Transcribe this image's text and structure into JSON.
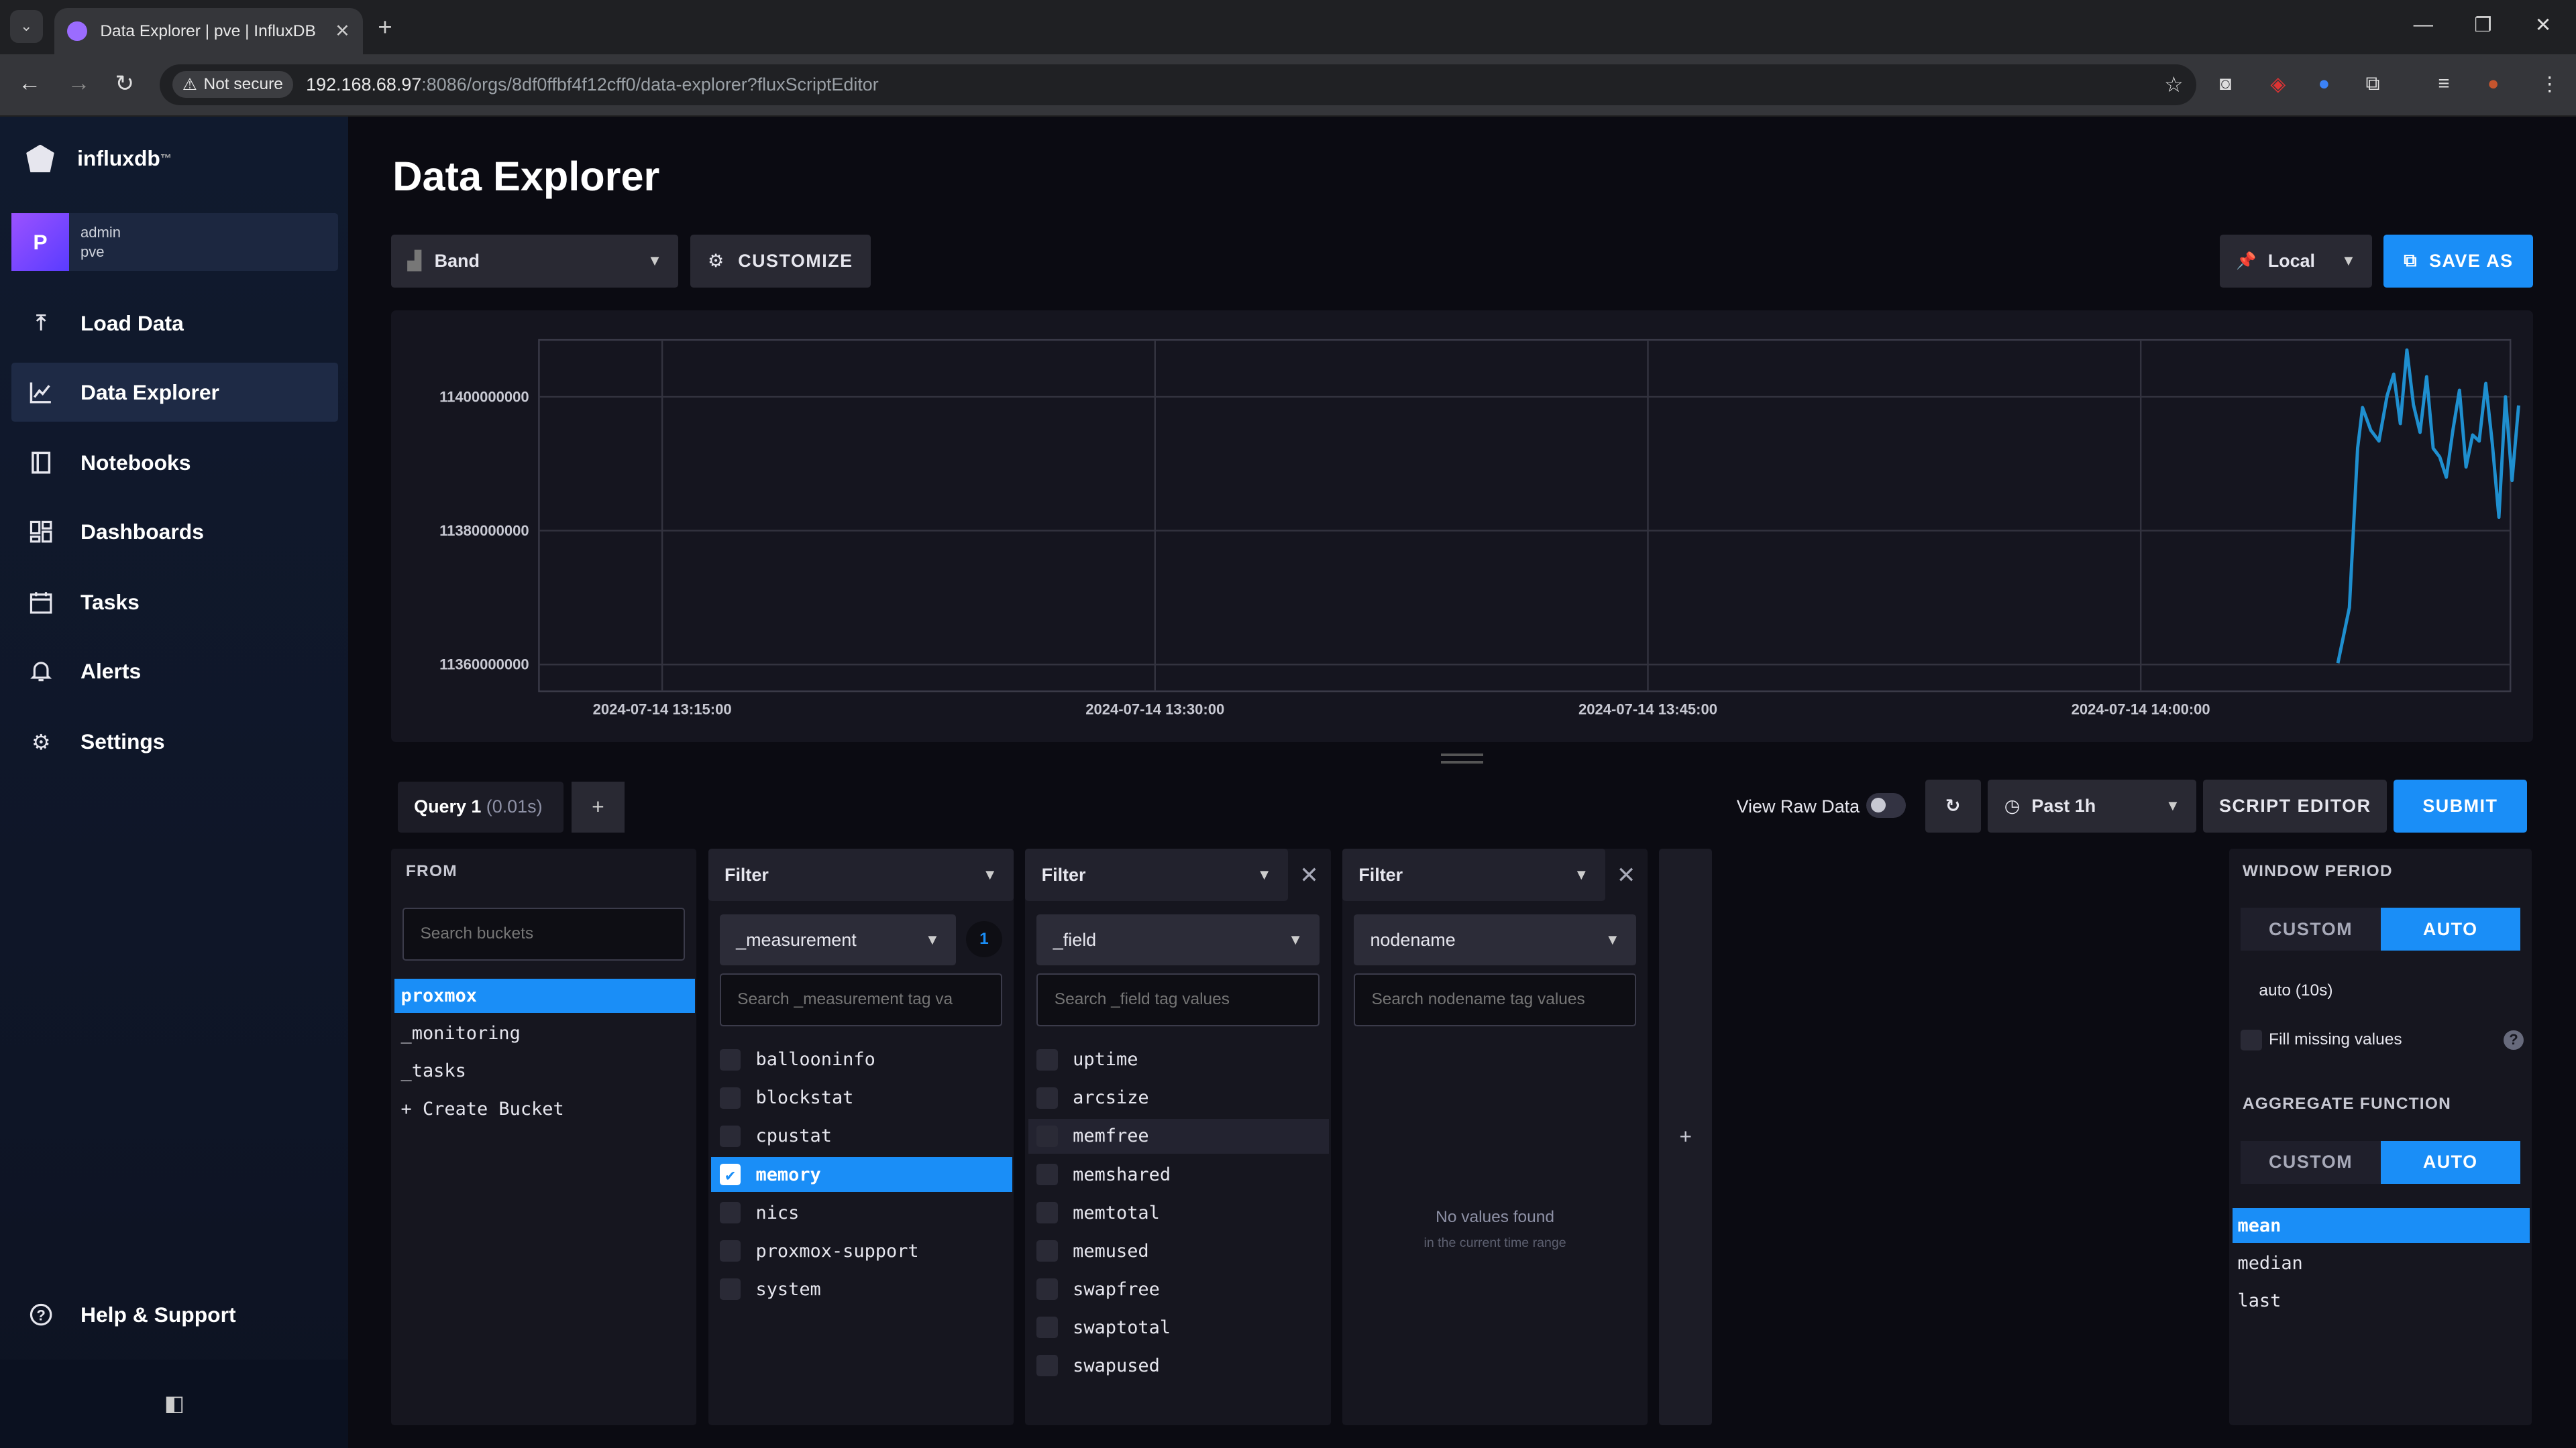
{
  "browser": {
    "tab_title": "Data Explorer | pve | InfluxDB",
    "not_secure": "Not secure",
    "url_host": "192.168.68.97",
    "url_path": ":8086/orgs/8df0ffbf4f12cff0/data-explorer?fluxScriptEditor"
  },
  "sidebar": {
    "brand": "influxdb",
    "brand_mark": "™",
    "user": {
      "initial": "P",
      "role": "admin",
      "org": "pve"
    },
    "items": [
      {
        "label": "Load Data",
        "icon": "upload-icon"
      },
      {
        "label": "Data Explorer",
        "icon": "graph-icon"
      },
      {
        "label": "Notebooks",
        "icon": "notebook-icon"
      },
      {
        "label": "Dashboards",
        "icon": "dashboard-icon"
      },
      {
        "label": "Tasks",
        "icon": "calendar-icon"
      },
      {
        "label": "Alerts",
        "icon": "bell-icon"
      },
      {
        "label": "Settings",
        "icon": "gear-icon"
      }
    ],
    "help": "Help & Support"
  },
  "page": {
    "title": "Data Explorer",
    "graph_type": "Band",
    "customize": "CUSTOMIZE",
    "timezone": "Local",
    "save_as": "SAVE AS"
  },
  "chart_data": {
    "type": "line",
    "yticks": [
      "11400000000",
      "11380000000",
      "11360000000"
    ],
    "ytick_values": [
      11400000000,
      11380000000,
      11360000000
    ],
    "ylim": [
      11356000000,
      11408500000
    ],
    "xticks": [
      "2024-07-14 13:15:00",
      "2024-07-14 13:30:00",
      "2024-07-14 13:45:00",
      "2024-07-14 14:00:00"
    ],
    "xtick_values": [
      2.5,
      17.5,
      32.5,
      47.5
    ],
    "xlim": [
      -1.25,
      58.75
    ],
    "x_unit": "minutes after 13:12:30",
    "series": [
      {
        "color": "#1f8fcf",
        "x": [
          53.5,
          53.85,
          54.1,
          54.25,
          54.5,
          54.75,
          55.0,
          55.2,
          55.4,
          55.6,
          55.8,
          56.0,
          56.2,
          56.4,
          56.6,
          56.8,
          57.0,
          57.2,
          57.4,
          57.6,
          57.8,
          58.0,
          58.2,
          58.4,
          58.6,
          58.8,
          59.0
        ],
        "y": [
          11360200000,
          11368500000,
          11392300000,
          11398400000,
          11395000000,
          11393400000,
          11400200000,
          11403400000,
          11396000000,
          11407000000,
          11398800000,
          11394700000,
          11403000000,
          11392300000,
          11391000000,
          11388000000,
          11395000000,
          11401000000,
          11389500000,
          11394300000,
          11393400000,
          11402000000,
          11393000000,
          11382000000,
          11400000000,
          11387500000,
          11398700000
        ]
      }
    ]
  },
  "query": {
    "tab_label": "Query 1",
    "tab_time": "(0.01s)",
    "view_raw": "View Raw Data",
    "time_range": "Past 1h",
    "script_editor": "SCRIPT EDITOR",
    "submit": "SUBMIT"
  },
  "from": {
    "header": "FROM",
    "search_placeholder": "Search buckets",
    "buckets": [
      "proxmox",
      "_monitoring",
      "_tasks"
    ],
    "create": "+ Create Bucket"
  },
  "filters": [
    {
      "title": "Filter",
      "key": "_measurement",
      "count": "1",
      "placeholder": "Search _measurement tag va",
      "values": [
        "ballooninfo",
        "blockstat",
        "cpustat",
        "memory",
        "nics",
        "proxmox-support",
        "system"
      ]
    },
    {
      "title": "Filter",
      "key": "_field",
      "placeholder": "Search _field tag values",
      "values": [
        "uptime",
        "arcsize",
        "memfree",
        "memshared",
        "memtotal",
        "memused",
        "swapfree",
        "swaptotal",
        "swapused"
      ]
    },
    {
      "title": "Filter",
      "key": "nodename",
      "placeholder": "Search nodename tag values",
      "empty": "No values found",
      "empty_sub": "in the current time range"
    }
  ],
  "add_filter": "+",
  "window": {
    "header": "WINDOW PERIOD",
    "custom": "CUSTOM",
    "auto": "AUTO",
    "value": "auto (10s)",
    "fill": "Fill missing values",
    "agg_header": "AGGREGATE FUNCTION",
    "functions": [
      "mean",
      "median",
      "last"
    ]
  }
}
